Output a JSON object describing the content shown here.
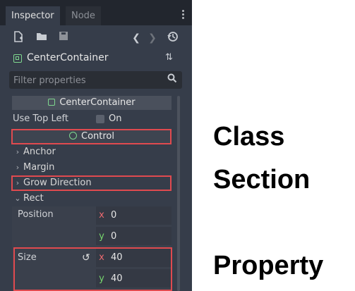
{
  "tabs": [
    {
      "label": "Inspector"
    },
    {
      "label": "Node"
    }
  ],
  "toolbar": {
    "icons": [
      "new-resource-icon",
      "open-folder-icon",
      "save-icon",
      "back-icon",
      "forward-icon",
      "history-icon"
    ],
    "back": "❮",
    "forward": "❯"
  },
  "object": {
    "name": "CenterContainer",
    "menu_icon": "⇅"
  },
  "filter": {
    "placeholder": "Filter properties",
    "search_icon": "🔍"
  },
  "inspector": {
    "class_name": "CenterContainer",
    "use_top_left": {
      "label": "Use Top Left",
      "value_label": "On"
    },
    "control_section": "Control",
    "sections": [
      "Anchor",
      "Margin",
      "Grow Direction",
      "Rect"
    ],
    "chev_right": "›",
    "chev_down": "⌄",
    "position": {
      "label": "Position",
      "x_key": "x",
      "x": "0",
      "y_key": "y",
      "y": "0"
    },
    "size": {
      "label": "Size",
      "reset_icon": "↺",
      "x_key": "x",
      "x": "40",
      "y_key": "y",
      "y": "40"
    }
  },
  "annotations": {
    "class": "Class",
    "section": "Section",
    "property": "Property"
  },
  "colors": {
    "panel_bg": "#363d4a",
    "highlight": "#e04a4f",
    "node_green": "#7fd88f",
    "axis_x": "#ec6a70",
    "axis_y": "#76d66d"
  }
}
